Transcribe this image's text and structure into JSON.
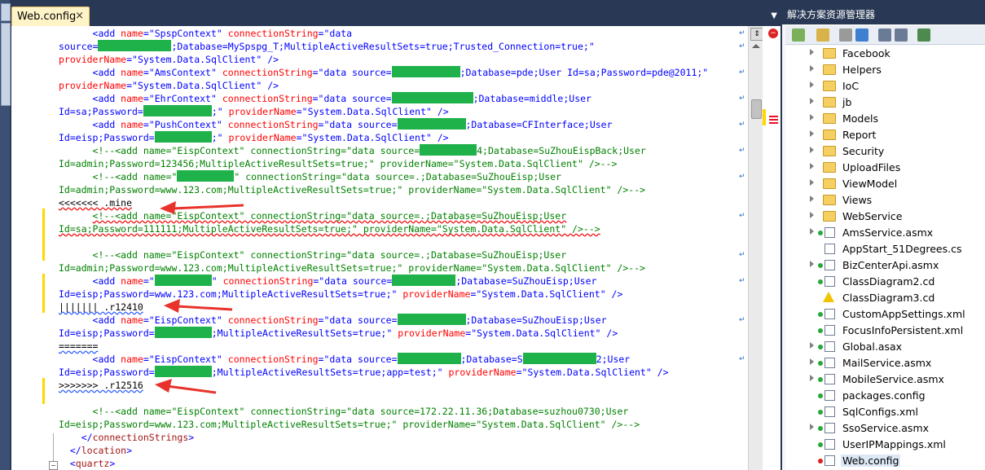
{
  "editor": {
    "tab_label": "Web.config",
    "tab_close": "×",
    "dropdown_glyph": "▼",
    "lines": [
      {
        "indent": "      ",
        "segments": [
          {
            "t": "<add ",
            "c": "b"
          },
          {
            "t": "name",
            "c": "att"
          },
          {
            "t": "=\"",
            "c": "b"
          },
          {
            "t": "SpspContext",
            "c": "b"
          },
          {
            "t": "\" ",
            "c": "b"
          },
          {
            "t": "connectionString",
            "c": "att"
          },
          {
            "t": "=\"",
            "c": "b"
          },
          {
            "t": "data",
            "c": "b"
          }
        ]
      },
      {
        "indent": "",
        "segments": [
          {
            "t": "source=",
            "c": "b"
          },
          {
            "mask": 90
          },
          {
            "t": ";Database=MySpspg_T;MultipleActiveResultSets=true;Trusted_Connection=true;\"",
            "c": "b"
          }
        ]
      },
      {
        "indent": "",
        "segments": [
          {
            "t": "providerName",
            "c": "att"
          },
          {
            "t": "=\"",
            "c": "b"
          },
          {
            "t": "System.Data.SqlClient",
            "c": "b"
          },
          {
            "t": "\" />",
            "c": "b"
          }
        ]
      },
      {
        "indent": "      ",
        "segments": [
          {
            "t": "<add ",
            "c": "b"
          },
          {
            "t": "name",
            "c": "att"
          },
          {
            "t": "=\"",
            "c": "b"
          },
          {
            "t": "AmsContext",
            "c": "b"
          },
          {
            "t": "\" ",
            "c": "b"
          },
          {
            "t": "connectionString",
            "c": "att"
          },
          {
            "t": "=\"",
            "c": "b"
          },
          {
            "t": "data source=",
            "c": "b"
          },
          {
            "mask": 84
          },
          {
            "t": ";Database=pde;User Id=sa;Password=pde@2011;\"",
            "c": "b"
          }
        ]
      },
      {
        "indent": "",
        "segments": [
          {
            "t": "providerName",
            "c": "att"
          },
          {
            "t": "=\"",
            "c": "b"
          },
          {
            "t": "System.Data.SqlClient",
            "c": "b"
          },
          {
            "t": "\" />",
            "c": "b"
          }
        ]
      },
      {
        "indent": "      ",
        "segments": [
          {
            "t": "<add ",
            "c": "b"
          },
          {
            "t": "name",
            "c": "att"
          },
          {
            "t": "=\"",
            "c": "b"
          },
          {
            "t": "EhrContext",
            "c": "b"
          },
          {
            "t": "\" ",
            "c": "b"
          },
          {
            "t": "connectionString",
            "c": "att"
          },
          {
            "t": "=\"",
            "c": "b"
          },
          {
            "t": "data source=",
            "c": "b"
          },
          {
            "mask": 100
          },
          {
            "t": ";Database=middle;User",
            "c": "b"
          }
        ]
      },
      {
        "indent": "",
        "segments": [
          {
            "t": "Id=sa;Password=",
            "c": "b"
          },
          {
            "mask": 84
          },
          {
            "t": ";\" ",
            "c": "b"
          },
          {
            "t": "providerName",
            "c": "att"
          },
          {
            "t": "=\"",
            "c": "b"
          },
          {
            "t": "System.Data.SqlClient",
            "c": "b"
          },
          {
            "t": "\" />",
            "c": "b"
          }
        ]
      },
      {
        "indent": "      ",
        "segments": [
          {
            "t": "<add ",
            "c": "b"
          },
          {
            "t": "name",
            "c": "att"
          },
          {
            "t": "=\"",
            "c": "b"
          },
          {
            "t": "PushContext",
            "c": "b"
          },
          {
            "t": "\" ",
            "c": "b"
          },
          {
            "t": "connectionString",
            "c": "att"
          },
          {
            "t": "=\"",
            "c": "b"
          },
          {
            "t": "data source=",
            "c": "b"
          },
          {
            "mask": 84
          },
          {
            "t": ";Database=CFInterface;User",
            "c": "b"
          }
        ]
      },
      {
        "indent": "",
        "segments": [
          {
            "t": "Id=eisp;Password=",
            "c": "b"
          },
          {
            "mask": 70
          },
          {
            "t": ";\" ",
            "c": "b"
          },
          {
            "t": "providerName",
            "c": "att"
          },
          {
            "t": "=\"",
            "c": "b"
          },
          {
            "t": "System.Data.SqlClient",
            "c": "b"
          },
          {
            "t": "\" />",
            "c": "b"
          }
        ]
      },
      {
        "indent": "      ",
        "segments": [
          {
            "t": "<!--<add name=\"EispContext\" connectionString=\"data source=",
            "c": "cm"
          },
          {
            "mask": 70
          },
          {
            "t": "4;Database=SuZhouEispBack;User",
            "c": "cm"
          }
        ]
      },
      {
        "indent": "",
        "segments": [
          {
            "t": "Id=admin;Password=123456;MultipleActiveResultSets=true;\" providerName=\"System.Data.SqlClient\" />-->",
            "c": "cm"
          }
        ]
      },
      {
        "indent": "      ",
        "segments": [
          {
            "t": "<!--<add name=\"",
            "c": "cm"
          },
          {
            "mask": 70
          },
          {
            "t": "\" connectionString=\"data source=.;Database=SuZhouEisp;User",
            "c": "cm"
          }
        ]
      },
      {
        "indent": "",
        "segments": [
          {
            "t": "Id=admin;Password=www.123.com;MultipleActiveResultSets=true;\" providerName=\"System.Data.SqlClient\" />-->",
            "c": "cm"
          }
        ]
      },
      {
        "indent": "",
        "segments": [
          {
            "t": "<<<<<<< .mine",
            "c": "k",
            "sq": "red"
          }
        ]
      },
      {
        "indent": "      ",
        "segments": [
          {
            "t": "<!--<add name=\"EispContext\" connectionString=\"data source=.;Database=SuZhouEisp;User",
            "c": "cm",
            "sq": "red"
          }
        ]
      },
      {
        "indent": "",
        "segments": [
          {
            "t": "Id=sa;Password=111111;MultipleActiveResultSets=true;\" providerName=\"System.Data.SqlClient\" />-->",
            "c": "cm",
            "sq": "red"
          }
        ]
      },
      {
        "indent": "",
        "segments": []
      },
      {
        "indent": "      ",
        "segments": [
          {
            "t": "<!--<add name=\"EispContext\" connectionString=\"data source=.;Database=SuZhouEisp;User",
            "c": "cm"
          }
        ]
      },
      {
        "indent": "",
        "segments": [
          {
            "t": "Id=admin;Password=www.123.com;MultipleActiveResultSets=true;\" providerName=\"System.Data.SqlClient\" />-->",
            "c": "cm"
          }
        ]
      },
      {
        "indent": "      ",
        "segments": [
          {
            "t": "<add ",
            "c": "b"
          },
          {
            "t": "name",
            "c": "att"
          },
          {
            "t": "=\"",
            "c": "b"
          },
          {
            "mask": 70
          },
          {
            "t": "\" ",
            "c": "b"
          },
          {
            "t": "connectionString",
            "c": "att"
          },
          {
            "t": "=\"",
            "c": "b"
          },
          {
            "t": "data source=",
            "c": "b"
          },
          {
            "mask": 78
          },
          {
            "t": ";Database=SuZhouEisp;User",
            "c": "b"
          }
        ]
      },
      {
        "indent": "",
        "segments": [
          {
            "t": "Id=eisp;Password=www.123.com;MultipleActiveResultSets=true;\" ",
            "c": "b"
          },
          {
            "t": "providerName",
            "c": "att"
          },
          {
            "t": "=\"",
            "c": "b"
          },
          {
            "t": "System.Data.SqlClient",
            "c": "b"
          },
          {
            "t": "\" />",
            "c": "b"
          }
        ]
      },
      {
        "indent": "",
        "segments": [
          {
            "t": "||||||| .r12410",
            "c": "k",
            "sq": "blue"
          }
        ]
      },
      {
        "indent": "      ",
        "segments": [
          {
            "t": "<add ",
            "c": "b"
          },
          {
            "t": "name",
            "c": "att"
          },
          {
            "t": "=\"",
            "c": "b"
          },
          {
            "t": "EispContext",
            "c": "b"
          },
          {
            "t": "\" ",
            "c": "b"
          },
          {
            "t": "connectionString",
            "c": "att"
          },
          {
            "t": "=\"",
            "c": "b"
          },
          {
            "t": "data source=",
            "c": "b"
          },
          {
            "mask": 84
          },
          {
            "t": ";Database=SuZhouEisp;User",
            "c": "b"
          }
        ]
      },
      {
        "indent": "",
        "segments": [
          {
            "t": "Id=eisp;Password=",
            "c": "b"
          },
          {
            "mask": 70
          },
          {
            "t": ";MultipleActiveResultSets=true;\" ",
            "c": "b"
          },
          {
            "t": "providerName",
            "c": "att"
          },
          {
            "t": "=\"",
            "c": "b"
          },
          {
            "t": "System.Data.SqlClient",
            "c": "b"
          },
          {
            "t": "\" />",
            "c": "b"
          }
        ]
      },
      {
        "indent": "",
        "segments": [
          {
            "t": "=======",
            "c": "k",
            "sq": "blue"
          }
        ]
      },
      {
        "indent": "      ",
        "segments": [
          {
            "t": "<add ",
            "c": "b"
          },
          {
            "t": "name",
            "c": "att"
          },
          {
            "t": "=\"",
            "c": "b"
          },
          {
            "t": "EispContext",
            "c": "b"
          },
          {
            "t": "\" ",
            "c": "b"
          },
          {
            "t": "connectionString",
            "c": "att"
          },
          {
            "t": "=\"",
            "c": "b"
          },
          {
            "t": "data source=",
            "c": "b"
          },
          {
            "mask": 78
          },
          {
            "t": ";Database=S",
            "c": "b"
          },
          {
            "mask": 90
          },
          {
            "t": "2;User",
            "c": "b"
          }
        ]
      },
      {
        "indent": "",
        "segments": [
          {
            "t": "Id=eisp;Password=",
            "c": "b"
          },
          {
            "mask": 70
          },
          {
            "t": ";MultipleActiveResultSets=true;app=test;\" ",
            "c": "b"
          },
          {
            "t": "providerName",
            "c": "att"
          },
          {
            "t": "=\"",
            "c": "b"
          },
          {
            "t": "System.Data.SqlClient",
            "c": "b"
          },
          {
            "t": "\" />",
            "c": "b"
          }
        ]
      },
      {
        "indent": "",
        "segments": [
          {
            "t": ">>>>>>> .r12516",
            "c": "k",
            "sq": "blue"
          }
        ]
      },
      {
        "indent": "",
        "segments": []
      },
      {
        "indent": "      ",
        "segments": [
          {
            "t": "<!--<add name=\"EispContext\" connectionString=\"data source=172.22.11.36;Database=suzhou0730;User",
            "c": "cm"
          }
        ]
      },
      {
        "indent": "",
        "segments": [
          {
            "t": "Id=eisp;Password=www.123.com;MultipleActiveResultSets=true;\" providerName=\"System.Data.SqlClient\" />-->",
            "c": "cm"
          }
        ]
      },
      {
        "indent": "    ",
        "segments": [
          {
            "t": "</",
            "c": "b"
          },
          {
            "t": "connectionStrings",
            "c": "r"
          },
          {
            "t": ">",
            "c": "b"
          }
        ]
      },
      {
        "indent": "  ",
        "segments": [
          {
            "t": "</",
            "c": "b"
          },
          {
            "t": "location",
            "c": "r"
          },
          {
            "t": ">",
            "c": "b"
          }
        ]
      },
      {
        "indent": "  ",
        "segments": [
          {
            "t": "<",
            "c": "b"
          },
          {
            "t": "quartz",
            "c": "r"
          },
          {
            "t": ">",
            "c": "b"
          }
        ]
      }
    ]
  },
  "solution_explorer": {
    "title": "解决方案资源管理器",
    "items": [
      {
        "label": "Facebook",
        "type": "folder",
        "expand": true
      },
      {
        "label": "Helpers",
        "type": "folder",
        "expand": true
      },
      {
        "label": "IoC",
        "type": "folder",
        "expand": true
      },
      {
        "label": "jb",
        "type": "folder",
        "expand": true
      },
      {
        "label": "Models",
        "type": "folder",
        "expand": true
      },
      {
        "label": "Report",
        "type": "folder",
        "expand": true
      },
      {
        "label": "Security",
        "type": "folder",
        "expand": true
      },
      {
        "label": "UploadFiles",
        "type": "folder",
        "expand": true
      },
      {
        "label": "ViewModel",
        "type": "folder",
        "expand": true
      },
      {
        "label": "Views",
        "type": "folder",
        "expand": true
      },
      {
        "label": "WebService",
        "type": "folder",
        "expand": true
      },
      {
        "label": "AmsService.asmx",
        "type": "file",
        "expand": true,
        "status": "green"
      },
      {
        "label": "AppStart_51Degrees.cs",
        "type": "file",
        "expand": false,
        "status": ""
      },
      {
        "label": "BizCenterApi.asmx",
        "type": "file",
        "expand": true,
        "status": "green"
      },
      {
        "label": "ClassDiagram2.cd",
        "type": "file",
        "expand": false,
        "status": "green"
      },
      {
        "label": "ClassDiagram3.cd",
        "type": "warn",
        "expand": false,
        "status": ""
      },
      {
        "label": "CustomAppSettings.xml",
        "type": "file",
        "expand": false,
        "status": "green"
      },
      {
        "label": "FocusInfoPersistent.xml",
        "type": "file",
        "expand": false,
        "status": "green"
      },
      {
        "label": "Global.asax",
        "type": "file",
        "expand": true,
        "status": "green"
      },
      {
        "label": "MailService.asmx",
        "type": "file",
        "expand": true,
        "status": "green"
      },
      {
        "label": "MobileService.asmx",
        "type": "file",
        "expand": true,
        "status": "green"
      },
      {
        "label": "packages.config",
        "type": "file",
        "expand": false,
        "status": "green"
      },
      {
        "label": "SqlConfigs.xml",
        "type": "file",
        "expand": false,
        "status": "green"
      },
      {
        "label": "SsoService.asmx",
        "type": "file",
        "expand": true,
        "status": "green"
      },
      {
        "label": "UserIPMappings.xml",
        "type": "file",
        "expand": false,
        "status": "green"
      },
      {
        "label": "Web.config",
        "type": "file",
        "expand": false,
        "status": "red",
        "selected": true
      }
    ]
  },
  "colors": {
    "accent_frame": "#293955",
    "conflict_margin": "#ffd800",
    "redact_mask": "#1fb24a",
    "arrow": "#e8322b"
  }
}
